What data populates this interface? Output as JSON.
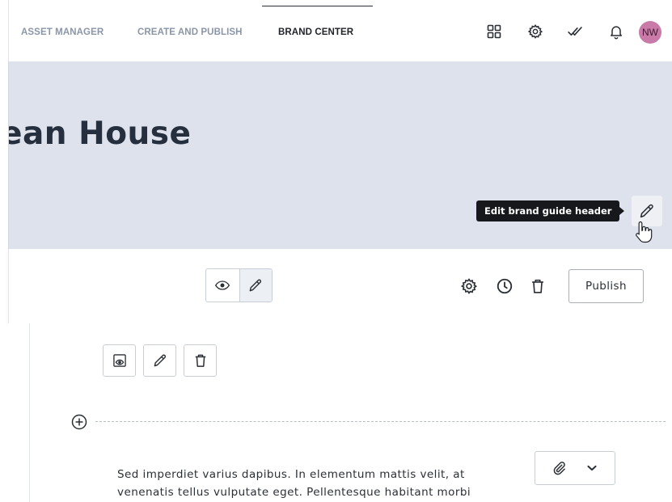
{
  "nav": {
    "tabs": [
      {
        "label": "ASSET MANAGER",
        "active": false
      },
      {
        "label": "CREATE AND PUBLISH",
        "active": false
      },
      {
        "label": "BRAND CENTER",
        "active": true
      }
    ],
    "icons": [
      "apps-grid-icon",
      "settings-gear-icon",
      "double-check-icon",
      "bell-icon"
    ],
    "avatar_initials": "NW",
    "avatar_color": "#c97aa8"
  },
  "header": {
    "title": "ean House",
    "background_color": "#dde2ec",
    "tooltip": "Edit brand guide header",
    "edit_icon": "pencil-icon"
  },
  "toolbar": {
    "view_toggle": [
      "eye-icon",
      "pencil-icon"
    ],
    "icons": [
      "settings-gear-icon",
      "clock-history-icon",
      "trash-icon"
    ],
    "publish_label": "Publish"
  },
  "content": {
    "block_tools": [
      "preview-icon",
      "pencil-icon",
      "trash-icon"
    ],
    "add_block_icon": "plus-circle-icon",
    "body_text": "Sed imperdiet varius dapibus. In elementum mattis velit, at venenatis tellus vulputate eget. Pellentesque habitant morbi",
    "attachment_tools": [
      "paperclip-icon",
      "chevron-down-icon"
    ]
  }
}
